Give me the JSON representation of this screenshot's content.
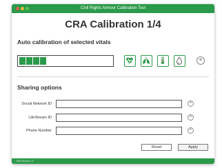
{
  "window": {
    "title": "Civil Rights Armour Calibration Tool"
  },
  "heading": "CRA Calibration 1/4",
  "calibration": {
    "section_title": "Auto calibration of selected vitals",
    "progress_fraction": 0.3,
    "vitals": [
      {
        "icon": "heartbeat-icon"
      },
      {
        "icon": "lungs-icon"
      },
      {
        "icon": "thermometer-icon"
      },
      {
        "icon": "sweat-drop-icon"
      }
    ],
    "add_icon": "plus-circle-icon"
  },
  "sharing": {
    "section_title": "Sharing options",
    "fields": [
      {
        "label": "Social Network ID",
        "value": ""
      },
      {
        "label": "LifeStream ID",
        "value": ""
      },
      {
        "label": "Phone Number",
        "value": ""
      }
    ]
  },
  "buttons": {
    "reset": "Reset",
    "apply": "Apply"
  },
  "status": {
    "version": "CRA Version 1.0"
  },
  "colors": {
    "accent": "#2b9a4a",
    "close": "#e05b4f",
    "minimize": "#e9b93a",
    "maximize": "#5dc04f"
  }
}
